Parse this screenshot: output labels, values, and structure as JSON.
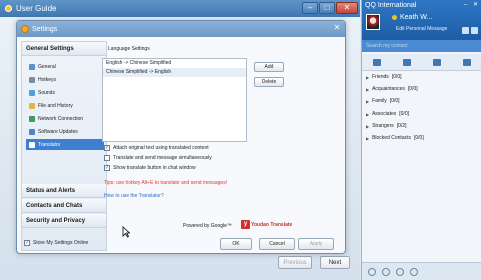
{
  "guide": {
    "title": "User Guide",
    "previous_label": "Previous",
    "next_label": "Next"
  },
  "settings": {
    "title": "Settings",
    "sidebar": {
      "general_header": "General Settings",
      "items": [
        {
          "label": "General",
          "icon": "settings-icon"
        },
        {
          "label": "Hotkeys",
          "icon": "keyboard-icon"
        },
        {
          "label": "Sounds",
          "icon": "speaker-icon"
        },
        {
          "label": "File and History",
          "icon": "folder-icon"
        },
        {
          "label": "Network Connection",
          "icon": "network-icon"
        },
        {
          "label": "Software Updates",
          "icon": "update-icon"
        },
        {
          "label": "Translator",
          "icon": "translator-icon"
        }
      ],
      "selected": "Translator",
      "status_header": "Status and Alerts",
      "contacts_header": "Contacts and Chats",
      "security_header": "Security and Privacy"
    },
    "language_settings_label": "Language Settings",
    "languages": [
      "English -> Chinese Simplified",
      "Chinese Simplified -> English"
    ],
    "add_label": "Add",
    "delete_label": "Delete",
    "options": [
      {
        "label": "Attach original text using translated content",
        "checked": true
      },
      {
        "label": "Translate and send message simultaneously",
        "checked": false
      },
      {
        "label": "Show translate button in chat window",
        "checked": true
      }
    ],
    "tip": "Tips: use hotkey Alt+E to translate and send messages!",
    "howto_link": "How to use the Translator?",
    "powered_by": "Powered by Google™",
    "youdao_label": "Youdao Translate",
    "store_label": "Store My Settings Online",
    "store_checked": true,
    "ok_label": "OK",
    "cancel_label": "Cancel",
    "apply_label": "Apply"
  },
  "qq": {
    "title": "QQ International",
    "name": "Keath W...",
    "personal_message": "Edit Personal Message",
    "search_placeholder": "Search my contact",
    "groups": [
      {
        "name": "Friends",
        "count": "[0/0]"
      },
      {
        "name": "Acquaintances",
        "count": "[0/0]"
      },
      {
        "name": "Family",
        "count": "[0/0]"
      },
      {
        "name": "Associates",
        "count": "[0/0]"
      },
      {
        "name": "Strangers",
        "count": "[0/2]"
      },
      {
        "name": "Blocked Contacts",
        "count": "[0/0]"
      }
    ]
  }
}
